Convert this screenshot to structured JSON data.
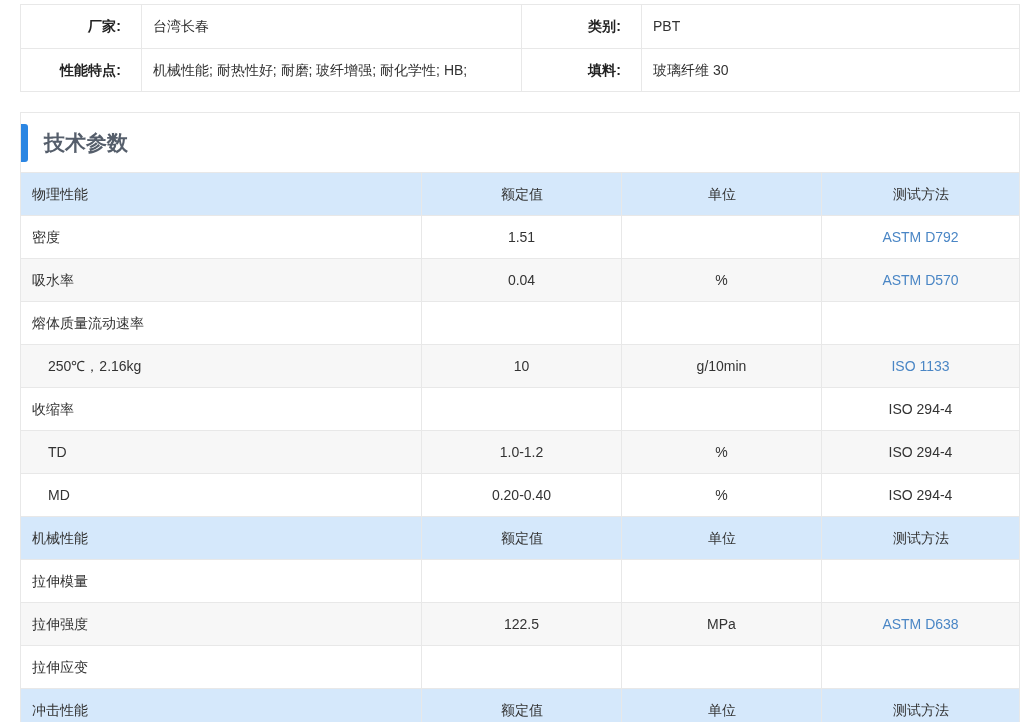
{
  "info": [
    {
      "label": "厂家:",
      "value": "台湾长春",
      "label2": "类别:",
      "value2": "PBT"
    },
    {
      "label": "性能特点:",
      "value": "机械性能; 耐热性好; 耐磨; 玻纤增强; 耐化学性; HB;",
      "label2": "填料:",
      "value2": "玻璃纤维 30"
    }
  ],
  "section_title": "技术参数",
  "rows": [
    {
      "kind": "header",
      "name": "物理性能",
      "value": "额定值",
      "unit": "单位",
      "method": "测试方法"
    },
    {
      "kind": "data",
      "name": "密度",
      "value": "1.51",
      "method": "ASTM D792",
      "method_link": true
    },
    {
      "kind": "data",
      "name": "吸水率",
      "value": "0.04",
      "unit": "%",
      "method": "ASTM D570",
      "method_link": true
    },
    {
      "kind": "data",
      "name": "熔体质量流动速率",
      "children": [
        {
          "name": "250℃，2.16kg",
          "value": "10",
          "unit": "g/10min",
          "method": "ISO 1133",
          "method_link": true
        }
      ]
    },
    {
      "kind": "data",
      "name": "收缩率",
      "method": "ISO 294-4",
      "method_link": false,
      "children": [
        {
          "name": "TD",
          "value": "1.0-1.2",
          "unit": "%",
          "method": "ISO 294-4",
          "method_link": false
        },
        {
          "name": "MD",
          "value": "0.20-0.40",
          "unit": "%",
          "method": "ISO 294-4",
          "method_link": false
        }
      ]
    },
    {
      "kind": "header",
      "name": "机械性能",
      "value": "额定值",
      "unit": "单位",
      "method": "测试方法"
    },
    {
      "kind": "data",
      "name": "拉伸模量"
    },
    {
      "kind": "data",
      "name": "拉伸强度",
      "value": "122.5",
      "unit": "MPa",
      "method": "ASTM D638",
      "method_link": true
    },
    {
      "kind": "data",
      "name": "拉伸应变"
    },
    {
      "kind": "header",
      "name": "冲击性能",
      "value": "额定值",
      "unit": "单位",
      "method": "测试方法"
    }
  ]
}
